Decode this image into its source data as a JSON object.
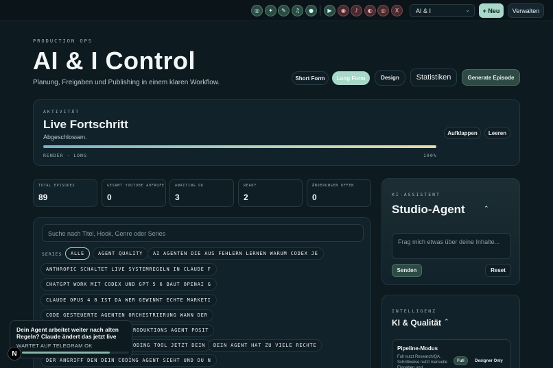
{
  "toolbar": {
    "icons": [
      {
        "name": "icon-1",
        "glyph": "◎",
        "tone": "g"
      },
      {
        "name": "icon-2",
        "glyph": "✦",
        "tone": "g"
      },
      {
        "name": "icon-3",
        "glyph": "✎",
        "tone": "g"
      },
      {
        "name": "icon-4",
        "glyph": "♫",
        "tone": "g"
      },
      {
        "name": "icon-5",
        "glyph": "●",
        "tone": "g"
      },
      {
        "name": "icon-6",
        "glyph": "▶",
        "tone": "g"
      },
      {
        "name": "icon-7",
        "glyph": "◉",
        "tone": "r"
      },
      {
        "name": "icon-8",
        "glyph": "♪",
        "tone": "r"
      },
      {
        "name": "icon-9",
        "glyph": "◐",
        "tone": "r"
      },
      {
        "name": "icon-10",
        "glyph": "◎",
        "tone": "r"
      },
      {
        "name": "icon-11",
        "glyph": "X",
        "tone": "r"
      }
    ],
    "project_select": "AI & I",
    "new_label": "+ Neu",
    "manage_label": "Verwalten"
  },
  "hero": {
    "eyebrow": "PRODUCTION OPS",
    "title": "AI & I Control",
    "subtitle": "Planung, Freigaben und Publishing in einem klaren Workflow."
  },
  "format_tabs": [
    "Short Form",
    "Long Form",
    "Design"
  ],
  "active_format": "Long Form",
  "stats_button": "Statistiken",
  "generate_button": "Generate Episode",
  "activity": {
    "eyebrow": "AKTIVITÄT",
    "title": "Live Fortschritt",
    "status": "Abgeschlossen.",
    "progress": 1.0,
    "stage": "RENDER · LONG",
    "percent": "100%",
    "expand_label": "Aufklappen",
    "clear_label": "Leeren"
  },
  "stats": [
    {
      "label": "TOTAL EPISODES",
      "value": "89"
    },
    {
      "label": "GESAMT YOUTUBE AUFRUFE",
      "value": "0"
    },
    {
      "label": "AWAITING OK",
      "value": "3"
    },
    {
      "label": "READY",
      "value": "2"
    },
    {
      "label": "ÄNDERUNGEN OFFEN",
      "value": "0"
    }
  ],
  "episodes": {
    "search_placeholder": "Suche nach Titel, Hook, Genre oder Series",
    "series_label": "SERIES",
    "chips": [
      "ALLE",
      "AGENT QUALITY",
      "AI AGENTEN DIE AUS FEHLERN LERNEN WARUM CODEX JE",
      "ANTHROPIC SCHALTET LIVE SYSTEMREGELN IN CLAUDE F",
      "CHATGPT WORK MIT CODEX UND GPT 5 6 BAUT OPENAI G",
      "CLAUDE OPUS 4 8 IST DA WER GEWINNT ECHTE MARKETI",
      "CODE GESTEUERTE AGENTEN ORCHESTRIERUNG WANN DER",
      "RODUKTIONS AGENT POSIT",
      "ODING TOOL JETZT DEIN",
      "DEIN AGENT HAT ZU VIELE RECHTE",
      "DER ANGRIFF DEN DEIN CODING AGENT SIEHT UND DU N"
    ]
  },
  "assistant": {
    "eyebrow": "KI-ASSISTENT",
    "title": "Studio-Agent",
    "input_placeholder": "Frag mich etwas über deine Inhalte...",
    "send_label": "Senden",
    "reset_label": "Reset"
  },
  "intelligence": {
    "eyebrow": "INTELLIGENZ",
    "title": "KI & Qualität",
    "pipeline_title": "Pipeline-Modus",
    "pipeline_desc": "Full nutzt Research/QA. Schrittweise nutzt manuelle Eingaben und",
    "full_label": "Full",
    "designer_label": "Designer Only"
  },
  "toast": {
    "title": "Dein Agent arbeitet weiter nach alten Regeln? Claude ändert das jetzt live",
    "status": "WARTET AUF TELEGRAM OK",
    "progress": 0.82
  },
  "badge": "N"
}
